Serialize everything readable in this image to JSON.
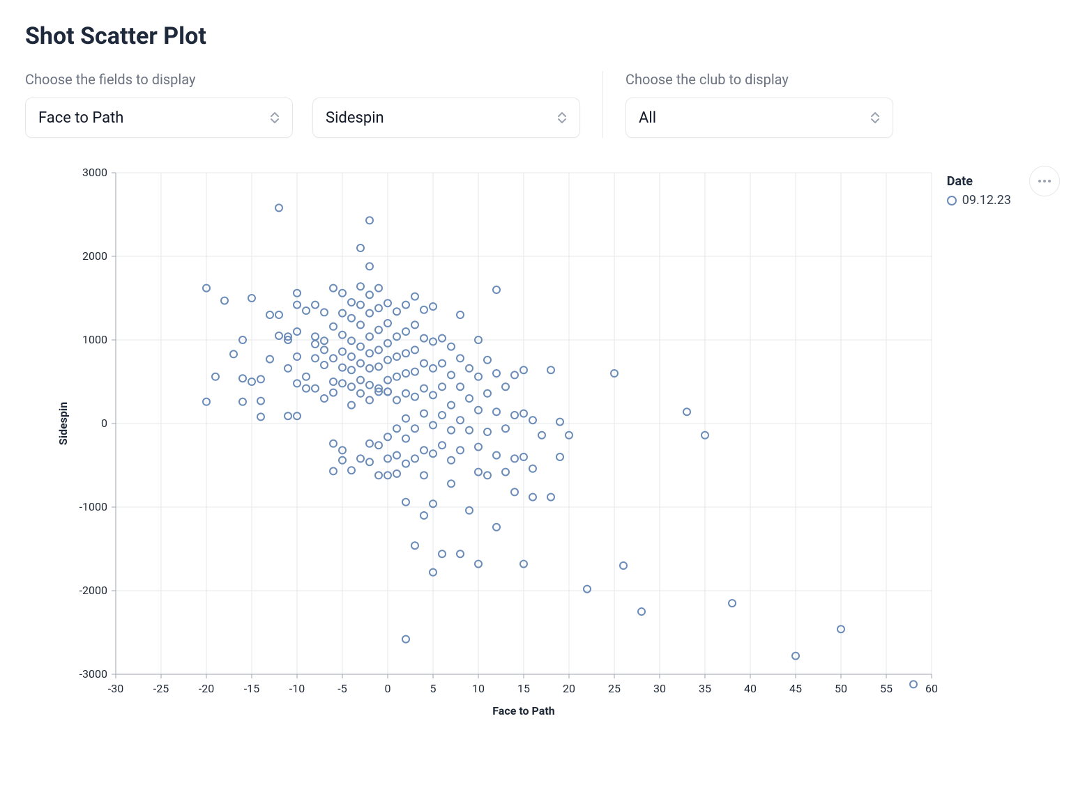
{
  "title": "Shot Scatter Plot",
  "controls": {
    "fields_label": "Choose the fields to display",
    "club_label": "Choose the club to display",
    "field_x": "Face to Path",
    "field_y": "Sidespin",
    "club": "All"
  },
  "legend": {
    "title": "Date",
    "item": "09.12.23"
  },
  "chart_data": {
    "type": "scatter",
    "xlabel": "Face to Path",
    "ylabel": "Sidespin",
    "xlim": [
      -30,
      60
    ],
    "ylim": [
      -3000,
      3000
    ],
    "xticks": [
      -30,
      -25,
      -20,
      -15,
      -10,
      -5,
      0,
      5,
      10,
      15,
      20,
      25,
      30,
      35,
      40,
      45,
      50,
      55,
      60
    ],
    "yticks": [
      -3000,
      -2000,
      -1000,
      0,
      1000,
      2000,
      3000
    ],
    "series": [
      {
        "name": "09.12.23",
        "points": [
          [
            -20,
            1620
          ],
          [
            -20,
            260
          ],
          [
            -19,
            560
          ],
          [
            -18,
            1470
          ],
          [
            -17,
            830
          ],
          [
            -16,
            1000
          ],
          [
            -16,
            540
          ],
          [
            -16,
            260
          ],
          [
            -15,
            1500
          ],
          [
            -15,
            500
          ],
          [
            -14,
            530
          ],
          [
            -14,
            270
          ],
          [
            -14,
            80
          ],
          [
            -13,
            1300
          ],
          [
            -13,
            770
          ],
          [
            -12,
            1050
          ],
          [
            -12,
            2580
          ],
          [
            -12,
            1300
          ],
          [
            -11,
            1000
          ],
          [
            -11,
            1040
          ],
          [
            -11,
            660
          ],
          [
            -11,
            90
          ],
          [
            -10,
            1420
          ],
          [
            -10,
            1560
          ],
          [
            -10,
            1100
          ],
          [
            -10,
            800
          ],
          [
            -10,
            480
          ],
          [
            -10,
            90
          ],
          [
            -9,
            1350
          ],
          [
            -9,
            560
          ],
          [
            -9,
            420
          ],
          [
            -8,
            1420
          ],
          [
            -8,
            1040
          ],
          [
            -8,
            780
          ],
          [
            -8,
            420
          ],
          [
            -8,
            950
          ],
          [
            -7,
            990
          ],
          [
            -7,
            1330
          ],
          [
            -7,
            880
          ],
          [
            -7,
            700
          ],
          [
            -7,
            300
          ],
          [
            -6,
            1620
          ],
          [
            -6,
            1160
          ],
          [
            -6,
            780
          ],
          [
            -6,
            500
          ],
          [
            -6,
            370
          ],
          [
            -6,
            -240
          ],
          [
            -6,
            -570
          ],
          [
            -5,
            1560
          ],
          [
            -5,
            1320
          ],
          [
            -5,
            1060
          ],
          [
            -5,
            860
          ],
          [
            -5,
            670
          ],
          [
            -5,
            480
          ],
          [
            -5,
            -320
          ],
          [
            -5,
            -440
          ],
          [
            -4,
            1450
          ],
          [
            -4,
            1260
          ],
          [
            -4,
            990
          ],
          [
            -4,
            800
          ],
          [
            -4,
            640
          ],
          [
            -4,
            440
          ],
          [
            -4,
            220
          ],
          [
            -4,
            -560
          ],
          [
            -3,
            2100
          ],
          [
            -3,
            1640
          ],
          [
            -3,
            1420
          ],
          [
            -3,
            1180
          ],
          [
            -3,
            920
          ],
          [
            -3,
            720
          ],
          [
            -3,
            520
          ],
          [
            -3,
            360
          ],
          [
            -3,
            -420
          ],
          [
            -2,
            2430
          ],
          [
            -2,
            1880
          ],
          [
            -2,
            1540
          ],
          [
            -2,
            1320
          ],
          [
            -2,
            1040
          ],
          [
            -2,
            840
          ],
          [
            -2,
            660
          ],
          [
            -2,
            460
          ],
          [
            -2,
            280
          ],
          [
            -2,
            -240
          ],
          [
            -2,
            -460
          ],
          [
            -1,
            1620
          ],
          [
            -1,
            1380
          ],
          [
            -1,
            1120
          ],
          [
            -1,
            880
          ],
          [
            -1,
            680
          ],
          [
            -1,
            420
          ],
          [
            -1,
            380
          ],
          [
            -1,
            -260
          ],
          [
            -1,
            -620
          ],
          [
            0,
            1440
          ],
          [
            0,
            1200
          ],
          [
            0,
            960
          ],
          [
            0,
            760
          ],
          [
            0,
            520
          ],
          [
            0,
            380
          ],
          [
            0,
            380
          ],
          [
            0,
            380
          ],
          [
            0,
            -160
          ],
          [
            0,
            -420
          ],
          [
            0,
            -620
          ],
          [
            1,
            1340
          ],
          [
            1,
            1040
          ],
          [
            1,
            800
          ],
          [
            1,
            560
          ],
          [
            1,
            280
          ],
          [
            1,
            -60
          ],
          [
            1,
            -380
          ],
          [
            1,
            -600
          ],
          [
            2,
            1420
          ],
          [
            2,
            1100
          ],
          [
            2,
            840
          ],
          [
            2,
            600
          ],
          [
            2,
            360
          ],
          [
            2,
            60
          ],
          [
            2,
            -180
          ],
          [
            2,
            -480
          ],
          [
            2,
            -940
          ],
          [
            2,
            -2580
          ],
          [
            3,
            1520
          ],
          [
            3,
            1180
          ],
          [
            3,
            880
          ],
          [
            3,
            620
          ],
          [
            3,
            320
          ],
          [
            3,
            -60
          ],
          [
            3,
            -420
          ],
          [
            3,
            -1460
          ],
          [
            4,
            1360
          ],
          [
            4,
            1020
          ],
          [
            4,
            720
          ],
          [
            4,
            420
          ],
          [
            4,
            120
          ],
          [
            4,
            -320
          ],
          [
            4,
            -620
          ],
          [
            4,
            -1100
          ],
          [
            5,
            980
          ],
          [
            5,
            1400
          ],
          [
            5,
            660
          ],
          [
            5,
            340
          ],
          [
            5,
            -20
          ],
          [
            5,
            -360
          ],
          [
            5,
            -960
          ],
          [
            5,
            -1780
          ],
          [
            6,
            1020
          ],
          [
            6,
            720
          ],
          [
            6,
            440
          ],
          [
            6,
            100
          ],
          [
            6,
            -260
          ],
          [
            6,
            -1560
          ],
          [
            7,
            920
          ],
          [
            7,
            580
          ],
          [
            7,
            220
          ],
          [
            7,
            -80
          ],
          [
            7,
            -440
          ],
          [
            7,
            -720
          ],
          [
            8,
            1300
          ],
          [
            8,
            780
          ],
          [
            8,
            440
          ],
          [
            8,
            40
          ],
          [
            8,
            -320
          ],
          [
            8,
            -1560
          ],
          [
            9,
            660
          ],
          [
            9,
            300
          ],
          [
            9,
            -80
          ],
          [
            9,
            -1040
          ],
          [
            10,
            1000
          ],
          [
            10,
            560
          ],
          [
            10,
            160
          ],
          [
            10,
            -280
          ],
          [
            10,
            -580
          ],
          [
            10,
            -1680
          ],
          [
            11,
            760
          ],
          [
            11,
            360
          ],
          [
            11,
            -100
          ],
          [
            11,
            -620
          ],
          [
            12,
            1600
          ],
          [
            12,
            600
          ],
          [
            12,
            140
          ],
          [
            12,
            -380
          ],
          [
            12,
            -1240
          ],
          [
            13,
            440
          ],
          [
            13,
            -60
          ],
          [
            13,
            -580
          ],
          [
            14,
            580
          ],
          [
            14,
            100
          ],
          [
            14,
            -420
          ],
          [
            14,
            -820
          ],
          [
            15,
            640
          ],
          [
            15,
            120
          ],
          [
            15,
            -400
          ],
          [
            15,
            -1680
          ],
          [
            16,
            40
          ],
          [
            16,
            -540
          ],
          [
            16,
            -880
          ],
          [
            17,
            -140
          ],
          [
            18,
            640
          ],
          [
            18,
            -880
          ],
          [
            19,
            20
          ],
          [
            19,
            -400
          ],
          [
            20,
            -140
          ],
          [
            22,
            -1980
          ],
          [
            25,
            600
          ],
          [
            26,
            -1700
          ],
          [
            28,
            -2250
          ],
          [
            33,
            140
          ],
          [
            35,
            -140
          ],
          [
            38,
            -2150
          ],
          [
            45,
            -2780
          ],
          [
            50,
            -2460
          ],
          [
            58,
            -3120
          ]
        ]
      }
    ]
  }
}
